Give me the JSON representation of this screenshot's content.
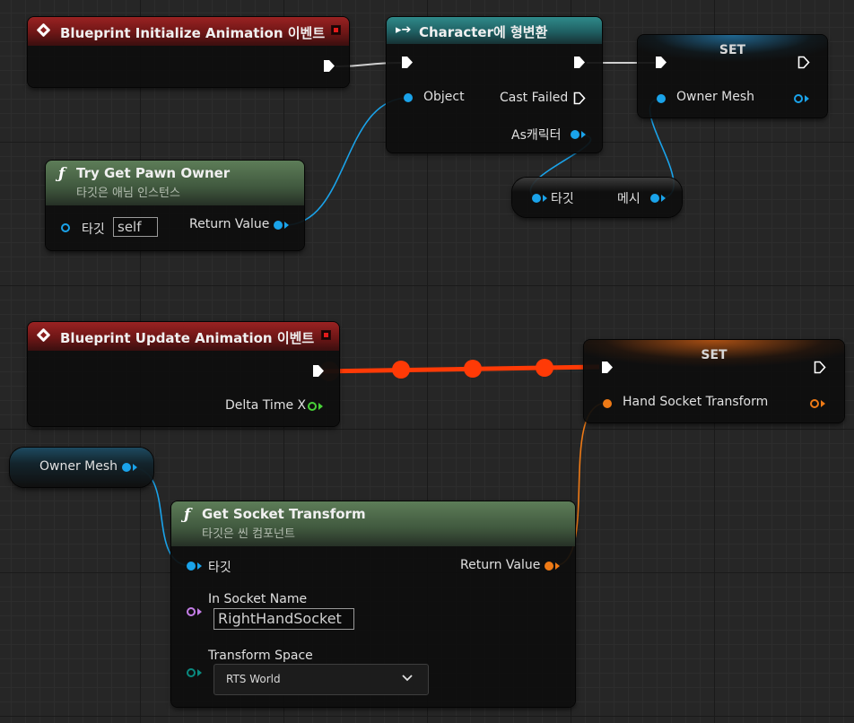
{
  "nodes": {
    "init_event": {
      "title": "Blueprint Initialize Animation 이벤트"
    },
    "cast": {
      "title": "Character에 형변환",
      "object_pin": "Object",
      "cast_failed": "Cast Failed",
      "as_character": "As캐릭터"
    },
    "set_mesh": {
      "title": "SET",
      "pin": "Owner Mesh"
    },
    "try_get_pawn": {
      "title": "Try Get Pawn Owner",
      "subtitle": "타깃은 애님 인스턴스",
      "target_label": "타깃",
      "target_value": "self",
      "return_value": "Return Value"
    },
    "mesh_getter": {
      "target": "타깃",
      "output": "메시"
    },
    "update_event": {
      "title": "Blueprint Update Animation 이벤트",
      "delta_time": "Delta Time X"
    },
    "set_hand": {
      "title": "SET",
      "pin": "Hand Socket Transform"
    },
    "owner_mesh_var": {
      "label": "Owner Mesh"
    },
    "get_socket": {
      "title": "Get Socket Transform",
      "subtitle": "타깃은 씬 컴포넌트",
      "target_label": "타깃",
      "return_value": "Return Value",
      "socket_name_label": "In Socket Name",
      "socket_name_value": "RightHandSocket",
      "space_label": "Transform Space",
      "space_value": "RTS World"
    }
  },
  "colors": {
    "object_pin": "#1aa3ea",
    "transform_pin": "#ee7a16",
    "float_pin": "#48d138",
    "name_pin": "#c57ee8",
    "enum_pin": "#0a8a80",
    "exec_active": "#ff3a06",
    "event_header": "#8a1d1d",
    "cast_header": "#2a7a7d",
    "function_header": "#50704b"
  },
  "icons": {
    "event": "event-diamond-icon",
    "cast": "cast-arrow-icon",
    "function": "function-f-icon",
    "exec": "exec-pin-icon",
    "close": "breakpoint-icon"
  }
}
